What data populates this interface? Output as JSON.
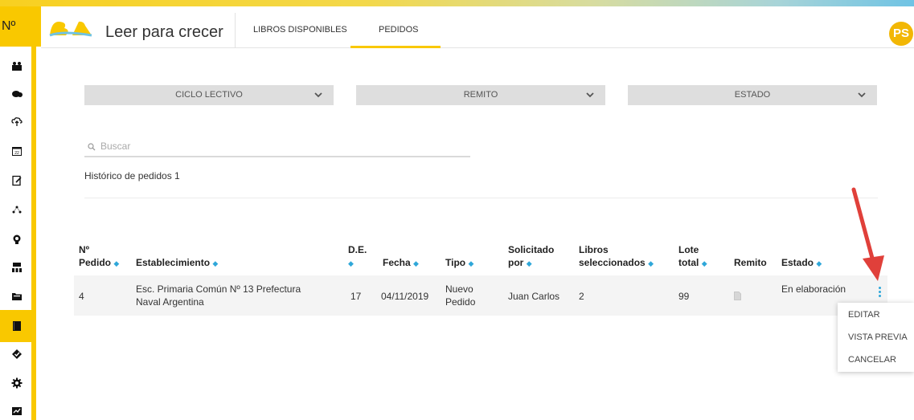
{
  "rail": {
    "top_label": "Nº"
  },
  "header": {
    "app_title": "Leer para crecer",
    "tabs": [
      {
        "label": "LIBROS DISPONIBLES"
      },
      {
        "label": "PEDIDOS"
      }
    ],
    "active_tab": "PEDIDOS",
    "avatar_initials": "PS"
  },
  "filters": [
    {
      "label": "CICLO LECTIVO"
    },
    {
      "label": "REMITO"
    },
    {
      "label": "ESTADO"
    }
  ],
  "search": {
    "placeholder": "Buscar",
    "value": ""
  },
  "history_label": "Histórico de pedidos 1",
  "table": {
    "headers": {
      "pedido_1": "Nº",
      "pedido_2": "Pedido",
      "establecimiento": "Establecimiento",
      "de": "D.E.",
      "fecha": "Fecha",
      "tipo": "Tipo",
      "solicitado_1": "Solicitado",
      "solicitado_2": "por",
      "libros_1": "Libros",
      "libros_2": "seleccionados",
      "lote_1": "Lote",
      "lote_2": "total",
      "remito": "Remito",
      "estado": "Estado"
    },
    "rows": [
      {
        "pedido": "4",
        "establecimiento_1": "Esc. Primaria Común Nº 13 Prefectura",
        "establecimiento_2": "Naval Argentina",
        "de": "17",
        "fecha": "04/11/2019",
        "tipo_1": "Nuevo",
        "tipo_2": "Pedido",
        "solicitado": "Juan Carlos",
        "libros": "2",
        "lote": "99",
        "estado": "En elaboración"
      }
    ]
  },
  "row_menu": {
    "items": [
      {
        "label": "EDITAR"
      },
      {
        "label": "VISTA PREVIA"
      },
      {
        "label": "CANCELAR"
      }
    ]
  },
  "colors": {
    "brand_yellow": "#f9c800",
    "sort_blue": "#2fa7d9",
    "annotation_red": "#e0403a"
  }
}
